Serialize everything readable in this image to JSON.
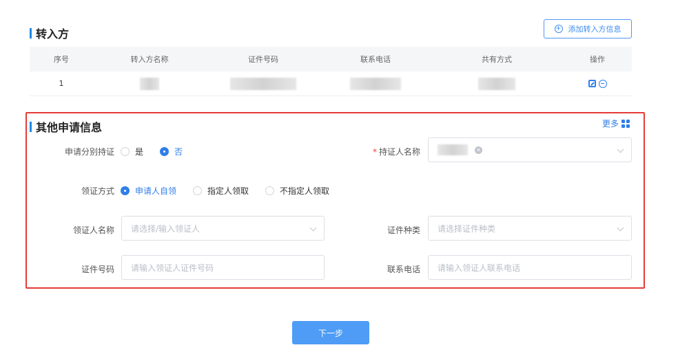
{
  "transferee": {
    "title": "转入方",
    "add_button": "添加转入方信息",
    "columns": [
      "序号",
      "转入方名称",
      "证件号码",
      "联系电话",
      "共有方式",
      "操作"
    ],
    "rows": [
      {
        "index": "1"
      }
    ]
  },
  "other_info": {
    "title": "其他申请信息",
    "more": "更多",
    "separate_cert": {
      "label": "申请分别持证",
      "options": [
        "是",
        "否"
      ],
      "selected": "否"
    },
    "holder_name": {
      "required_mark": "*",
      "label": "持证人名称"
    },
    "collect_method": {
      "label": "领证方式",
      "options": [
        "申请人自领",
        "指定人领取",
        "不指定人领取"
      ],
      "selected": "申请人自领"
    },
    "collector_name": {
      "label": "领证人名称",
      "placeholder": "请选择/输入领证人"
    },
    "cert_type": {
      "label": "证件种类",
      "placeholder": "请选择证件种类"
    },
    "cert_number": {
      "label": "证件号码",
      "placeholder": "请输入领证人证件号码"
    },
    "phone": {
      "label": "联系电话",
      "placeholder": "请输入领证人联系电话"
    }
  },
  "next_button": "下一步",
  "colors": {
    "accent": "#2f7ee8",
    "highlight_border": "#e53935",
    "primary_button": "#4e9cf5"
  }
}
